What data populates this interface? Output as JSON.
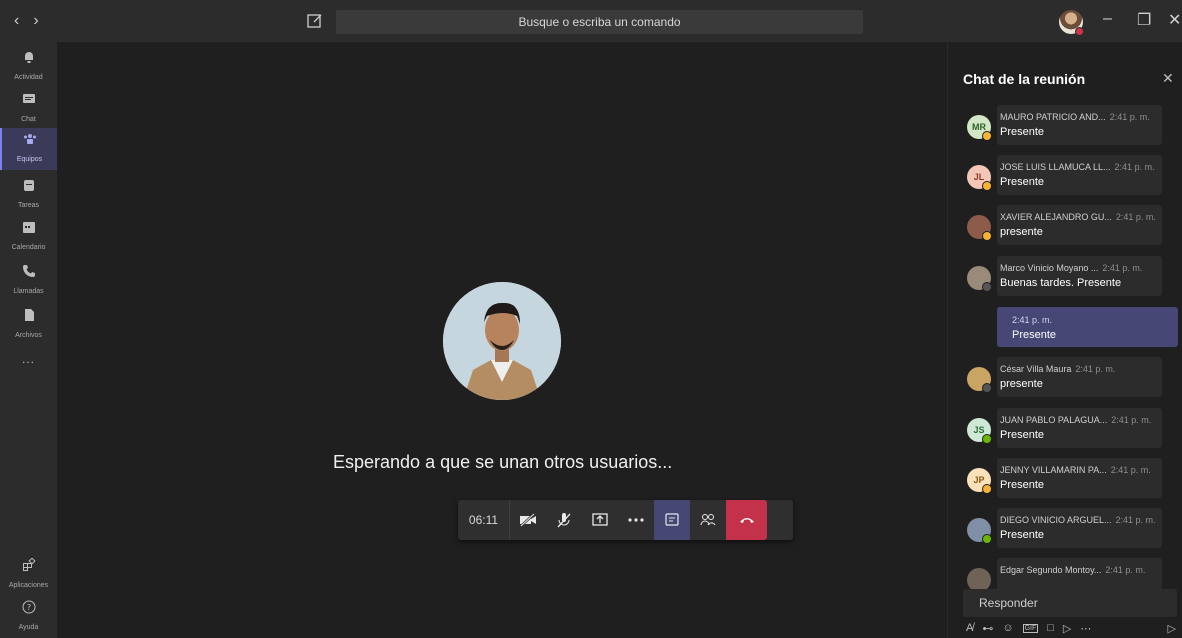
{
  "search": {
    "placeholder": "Busque o escriba un comando"
  },
  "rail": {
    "items": [
      {
        "label": "Actividad",
        "icon": "bell-icon"
      },
      {
        "label": "Chat",
        "icon": "chat-icon"
      },
      {
        "label": "Equipos",
        "icon": "teams-icon"
      },
      {
        "label": "Tareas",
        "icon": "tasks-icon"
      },
      {
        "label": "Calendario",
        "icon": "calendar-icon"
      },
      {
        "label": "Llamadas",
        "icon": "phone-icon"
      },
      {
        "label": "Archivos",
        "icon": "files-icon"
      }
    ],
    "more": "...",
    "apps": "Aplicaciones",
    "help": "Ayuda"
  },
  "meeting": {
    "waiting_text": "Esperando a que se unan otros usuarios...",
    "timer": "06:11"
  },
  "chat": {
    "title": "Chat de la reunión",
    "messages": [
      {
        "initials": "MR",
        "name": "MAURO PATRICIO AND...",
        "time": "2:41 p. m.",
        "text": "Presente",
        "av_bg": "#d2e7c6",
        "av_fg": "#2f5f2a",
        "badge": "#f8b333"
      },
      {
        "initials": "JL",
        "name": "JOSE LUIS LLAMUCA LL...",
        "time": "2:41 p. m.",
        "text": "Presente",
        "av_bg": "#f4c6b8",
        "av_fg": "#8a3a25",
        "badge": "#f8b333"
      },
      {
        "initials": "",
        "name": "XAVIER ALEJANDRO GU...",
        "time": "2:41 p. m.",
        "text": "presente",
        "av_bg": "#8d5b4a",
        "av_fg": "#fff",
        "badge": "#f8b333"
      },
      {
        "initials": "",
        "name": "Marco Vinicio Moyano ...",
        "time": "2:41 p. m.",
        "text": "Buenas tardes. Presente",
        "av_bg": "#9a8a7a",
        "av_fg": "#fff",
        "badge": "#555555"
      }
    ],
    "mine": {
      "time": "2:41 p. m.",
      "text": "Presente"
    },
    "messages2": [
      {
        "initials": "",
        "name": "César Villa Maura",
        "time": "2:41 p. m.",
        "text": "presente",
        "av_bg": "#c9a463",
        "av_fg": "#fff",
        "badge": "#555555"
      },
      {
        "initials": "JS",
        "name": "JUAN PABLO PALAGUA...",
        "time": "2:41 p. m.",
        "text": "Presente",
        "av_bg": "#cde8d4",
        "av_fg": "#2f6b3c",
        "badge": "#6bb700"
      },
      {
        "initials": "JP",
        "name": "JENNY VILLAMARIN PA...",
        "time": "2:41 p. m.",
        "text": "Presente",
        "av_bg": "#fbe1b9",
        "av_fg": "#8a5a13",
        "badge": "#f8b333"
      },
      {
        "initials": "",
        "name": "DIEGO VINICIO ARGUEL...",
        "time": "2:41 p. m.",
        "text": "Presente",
        "av_bg": "#7f8fa6",
        "av_fg": "#fff",
        "badge": "#6bb700"
      },
      {
        "initials": "",
        "name": "Edgar Segundo Montoy...",
        "time": "2:41 p. m.",
        "text": "",
        "av_bg": "#6f6256",
        "av_fg": "#fff",
        "badge": ""
      }
    ],
    "reply_placeholder": "Responder"
  }
}
